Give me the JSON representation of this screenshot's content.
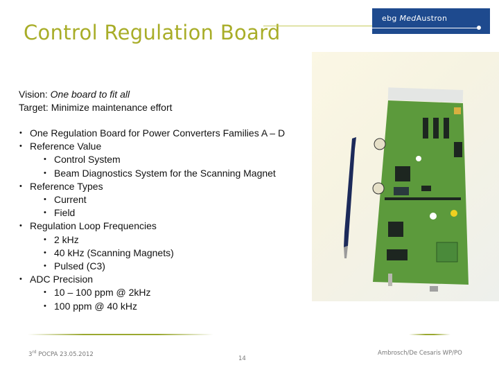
{
  "header": {
    "title": "Control Regulation Board",
    "logo": {
      "prefix": "ebg ",
      "italic": "Med",
      "suffix": "Austron",
      "bg_color": "#1e4a8e"
    },
    "title_color": "#a8ad28"
  },
  "intro": {
    "vision_label": "Vision: ",
    "vision_value": "One board to fit all",
    "target": "Target: Minimize maintenance effort"
  },
  "bullets": [
    {
      "level": 1,
      "text": "One Regulation Board for Power Converters Families A – D"
    },
    {
      "level": 1,
      "text": "Reference Value"
    },
    {
      "level": 2,
      "text": "Control System"
    },
    {
      "level": 2,
      "text": "Beam Diagnostics System for the Scanning Magnet"
    },
    {
      "level": 1,
      "text": "Reference Types"
    },
    {
      "level": 2,
      "text": "Current"
    },
    {
      "level": 2,
      "text": "Field"
    },
    {
      "level": 1,
      "text": "Regulation Loop Frequencies"
    },
    {
      "level": 2,
      "text": "2 kHz"
    },
    {
      "level": 2,
      "text": "40 kHz (Scanning Magnets)"
    },
    {
      "level": 2,
      "text": "Pulsed (C3)"
    },
    {
      "level": 1,
      "text": "ADC Precision"
    },
    {
      "level": 2,
      "text": "10 – 100 ppm @ 2kHz"
    },
    {
      "level": 2,
      "text": "100 ppm @ 40 kHz"
    }
  ],
  "image": {
    "description": "Photo of green regulation circuit board next to a blue pen"
  },
  "footer": {
    "event_num": "3",
    "event_sup": "rd",
    "event_rest": " POCPA 23.05.2012",
    "page_number": "14",
    "authors": "Ambrosch/De Cesaris WP/PO"
  }
}
